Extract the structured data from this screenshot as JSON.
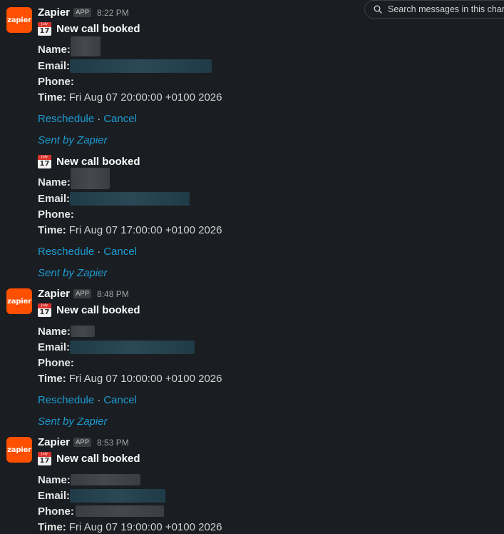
{
  "search": {
    "placeholder": "Search messages in this chan"
  },
  "avatar_text": "zapier",
  "app_badge": "APP",
  "field_labels": {
    "name": "Name:",
    "email": "Email:",
    "phone": "Phone:",
    "time": "Time:"
  },
  "link_labels": {
    "reschedule": "Reschedule",
    "separator": "·",
    "cancel": "Cancel",
    "sent_by": "Sent by Zapier"
  },
  "calendar_icon": {
    "month": "July",
    "day": "17"
  },
  "messages": [
    {
      "sender": "Zapier",
      "timestamp": "8:22 PM",
      "title": "New call booked",
      "time_value": "Fri Aug 07 20:00:00 +0100 2026"
    },
    {
      "title": "New call booked",
      "time_value": "Fri Aug 07 17:00:00 +0100 2026"
    },
    {
      "sender": "Zapier",
      "timestamp": "8:48 PM",
      "title": "New call booked",
      "time_value": "Fri Aug 07 10:00:00 +0100 2026"
    },
    {
      "sender": "Zapier",
      "timestamp": "8:53 PM",
      "title": "New call booked",
      "time_value": "Fri Aug 07 19:00:00 +0100 2026"
    }
  ],
  "colors": {
    "background": "#1a1d21",
    "link": "#1d9bd1",
    "zapier_orange": "#ff4f00"
  }
}
